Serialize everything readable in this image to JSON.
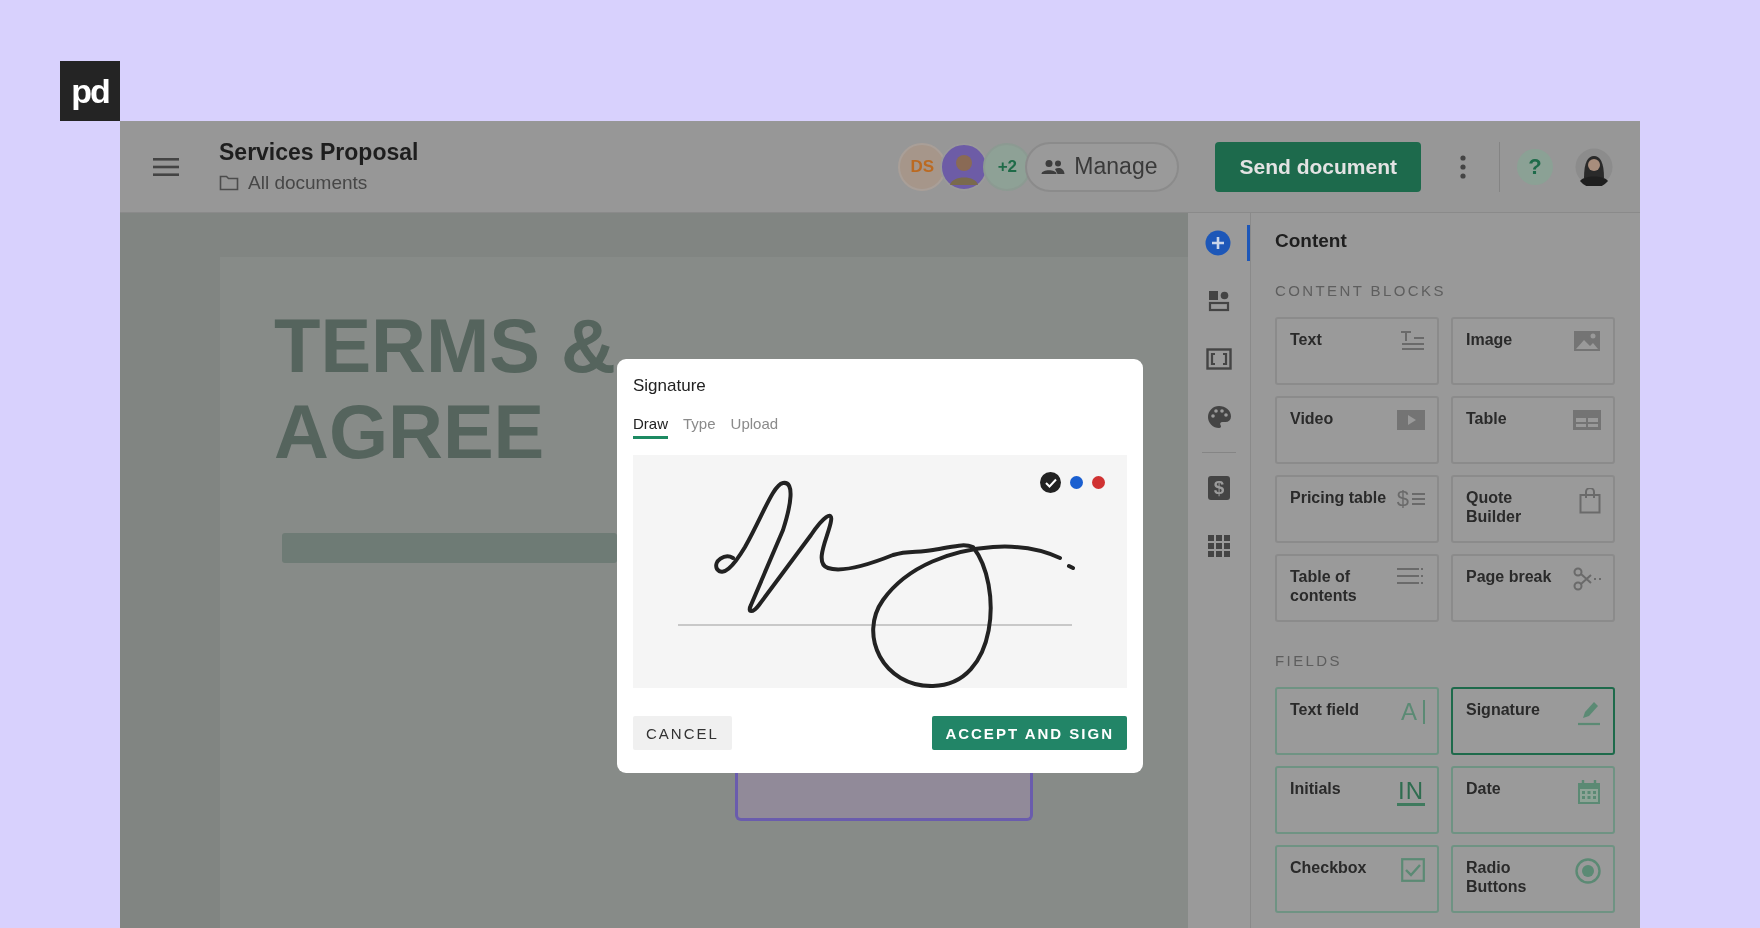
{
  "logo": {
    "text": "pd"
  },
  "header": {
    "title": "Services Proposal",
    "breadcrumb": "All documents",
    "collaborators": [
      {
        "kind": "initials",
        "text": "DS"
      },
      {
        "kind": "photo"
      },
      {
        "kind": "count",
        "text": "+2"
      }
    ],
    "manage_label": "Manage",
    "send_label": "Send document",
    "help_label": "?"
  },
  "document": {
    "heading_lines": [
      "TERMS &",
      "AGREE"
    ]
  },
  "rail": [
    {
      "selected": true
    },
    {
      "selected": false
    },
    {
      "selected": false
    },
    {
      "selected": false
    },
    {
      "glyph": "$",
      "selected": false
    },
    {
      "selected": false
    }
  ],
  "panel": {
    "title": "Content",
    "sections": [
      {
        "heading": "CONTENT BLOCKS",
        "kind": "blocks",
        "items": [
          {
            "label": "Text",
            "selected": false
          },
          {
            "label": "Image",
            "selected": false
          },
          {
            "label": "Video",
            "selected": false
          },
          {
            "label": "Table",
            "selected": false
          },
          {
            "label": "Pricing table",
            "glyph": "$",
            "selected": false
          },
          {
            "label": "Quote Builder",
            "selected": false
          },
          {
            "label": "Table of contents",
            "selected": false
          },
          {
            "label": "Page break",
            "selected": false
          }
        ]
      },
      {
        "heading": "FIELDS",
        "kind": "fields",
        "items": [
          {
            "label": "Text field",
            "glyph": "A",
            "selected": false
          },
          {
            "label": "Signature",
            "selected": true
          },
          {
            "label": "Initials",
            "glyph": "IN",
            "selected": false
          },
          {
            "label": "Date",
            "selected": false
          },
          {
            "label": "Checkbox",
            "selected": false
          },
          {
            "label": "Radio Buttons",
            "selected": false
          }
        ]
      }
    ]
  },
  "modal": {
    "title": "Signature",
    "tabs": [
      {
        "label": "Draw",
        "selected": true
      },
      {
        "label": "Type",
        "selected": false
      },
      {
        "label": "Upload",
        "selected": false
      }
    ],
    "ink_colors": [
      {
        "color": "#222222",
        "selected": true
      },
      {
        "color": "#1a5fd0",
        "selected": false
      },
      {
        "color": "#d03232",
        "selected": false
      }
    ],
    "cancel_label": "CANCEL",
    "accept_label": "ACCEPT AND SIGN"
  }
}
